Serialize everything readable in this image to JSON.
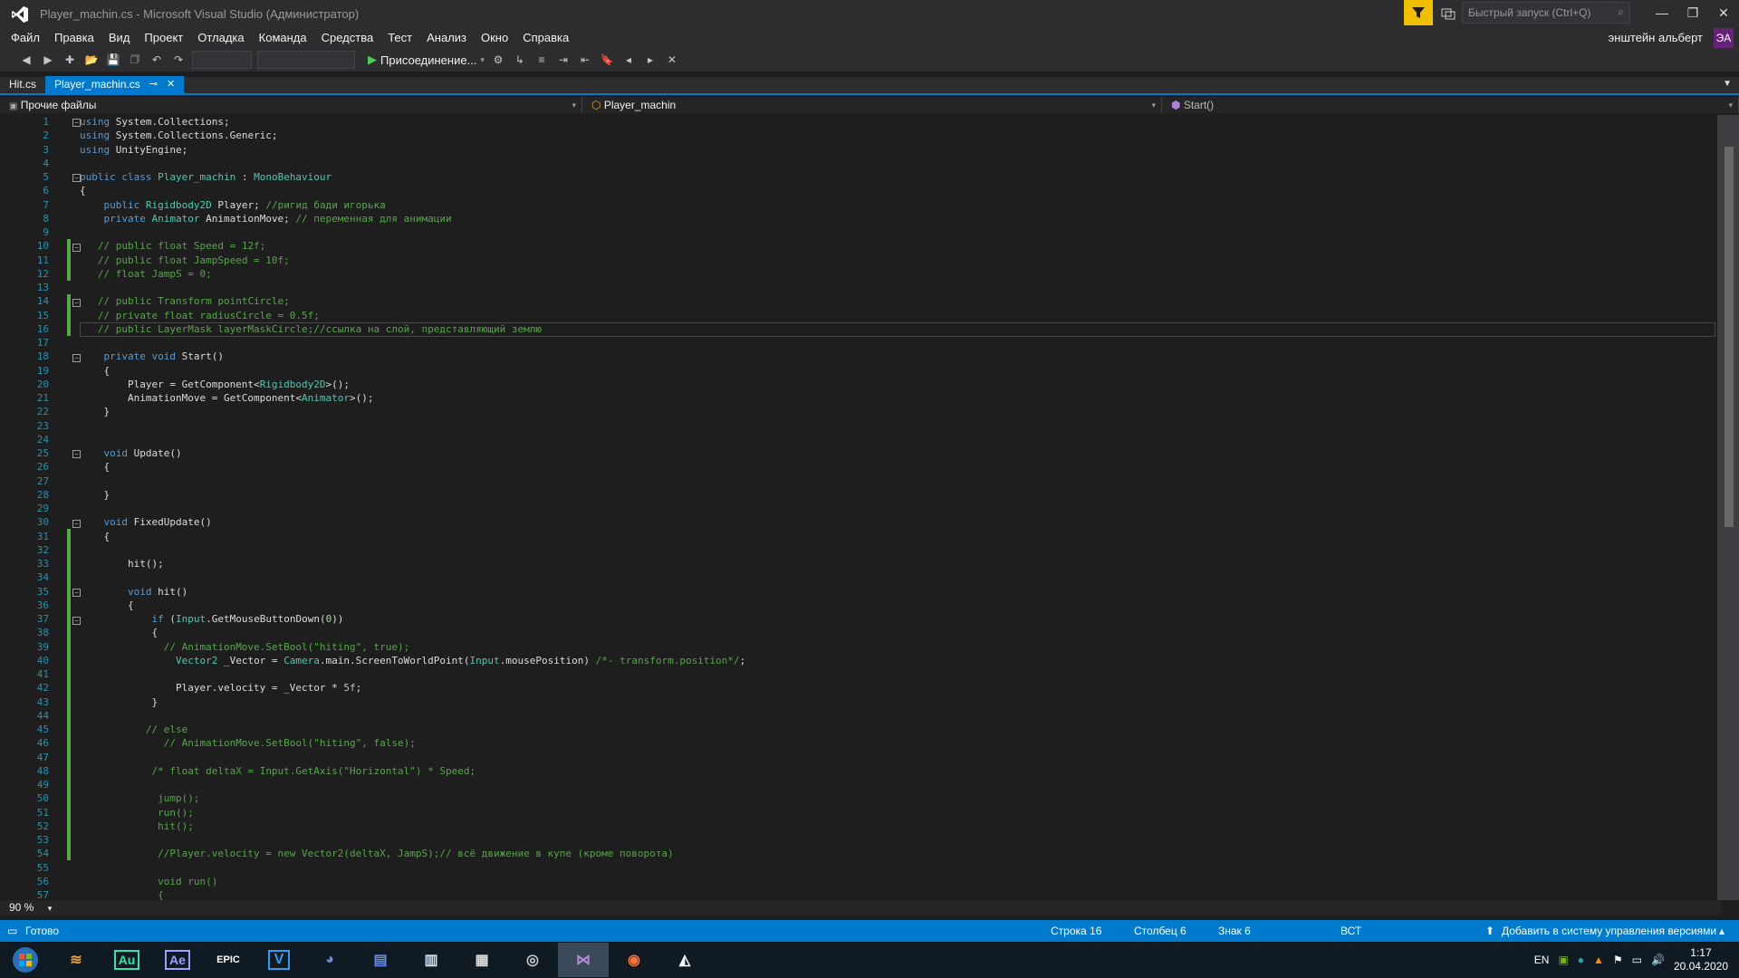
{
  "titlebar": {
    "title": "Player_machin.cs - Microsoft Visual Studio  (Администратор)",
    "quick_launch_placeholder": "Быстрый запуск (Ctrl+Q)",
    "user_name": "энштейн альберт",
    "avatar_initials": "ЭА"
  },
  "menu": [
    "Файл",
    "Правка",
    "Вид",
    "Проект",
    "Отладка",
    "Команда",
    "Средства",
    "Тест",
    "Анализ",
    "Окно",
    "Справка"
  ],
  "toolbar": {
    "attach_label": "Присоединение..."
  },
  "tabs": [
    {
      "label": "Hit.cs",
      "active": false
    },
    {
      "label": "Player_machin.cs",
      "active": true
    }
  ],
  "navbar": {
    "project": "Прочие файлы",
    "class": "Player_machin",
    "member": "Start()"
  },
  "code": {
    "current_line": 16,
    "lines": [
      {
        "n": 1,
        "html": "<span class='kw'>using</span> System.Collections;"
      },
      {
        "n": 2,
        "html": "<span class='kw'>using</span> System.Collections.Generic;"
      },
      {
        "n": 3,
        "html": "<span class='kw'>using</span> UnityEngine;"
      },
      {
        "n": 4,
        "html": ""
      },
      {
        "n": 5,
        "html": "<span class='kw'>public class</span> <span class='ty'>Player_machin</span> : <span class='ty'>MonoBehaviour</span>"
      },
      {
        "n": 6,
        "html": "{"
      },
      {
        "n": 7,
        "html": "    <span class='kw'>public</span> <span class='ty'>Rigidbody2D</span> Player; <span class='cm'>//ригид бади игорька</span>"
      },
      {
        "n": 8,
        "html": "    <span class='kw'>private</span> <span class='ty'>Animator</span> AnimationMove; <span class='cm'>// переменная для анимации</span>"
      },
      {
        "n": 9,
        "html": ""
      },
      {
        "n": 10,
        "html": "   <span class='cm'>// public float Speed = 12f;</span>"
      },
      {
        "n": 11,
        "html": "   <span class='cm'>// public float JampSpeed = 10f;</span>"
      },
      {
        "n": 12,
        "html": "   <span class='cm'>// float JampS = 0;</span>"
      },
      {
        "n": 13,
        "html": ""
      },
      {
        "n": 14,
        "html": "   <span class='cm'>// public Transform pointCircle;</span>"
      },
      {
        "n": 15,
        "html": "   <span class='cm'>// private float radiusCircle = 0.5f;</span>"
      },
      {
        "n": 16,
        "html": "   <span class='cm'>// public LayerMask layerMaskCircle;//ссылка на слой, представляющий землю</span>"
      },
      {
        "n": 17,
        "html": ""
      },
      {
        "n": 18,
        "html": "    <span class='kw'>private void</span> Start()"
      },
      {
        "n": 19,
        "html": "    {"
      },
      {
        "n": 20,
        "html": "        Player = GetComponent&lt;<span class='ty'>Rigidbody2D</span>&gt;();"
      },
      {
        "n": 21,
        "html": "        AnimationMove = GetComponent&lt;<span class='ty'>Animator</span>&gt;();"
      },
      {
        "n": 22,
        "html": "    }"
      },
      {
        "n": 23,
        "html": ""
      },
      {
        "n": 24,
        "html": ""
      },
      {
        "n": 25,
        "html": "    <span class='kw'>void</span> Update()"
      },
      {
        "n": 26,
        "html": "    {"
      },
      {
        "n": 27,
        "html": ""
      },
      {
        "n": 28,
        "html": "    }"
      },
      {
        "n": 29,
        "html": ""
      },
      {
        "n": 30,
        "html": "    <span class='kw'>void</span> FixedUpdate()"
      },
      {
        "n": 31,
        "html": "    {"
      },
      {
        "n": 32,
        "html": ""
      },
      {
        "n": 33,
        "html": "        hit();"
      },
      {
        "n": 34,
        "html": ""
      },
      {
        "n": 35,
        "html": "        <span class='kw'>void</span> hit()"
      },
      {
        "n": 36,
        "html": "        {"
      },
      {
        "n": 37,
        "html": "            <span class='kw'>if</span> (<span class='ty'>Input</span>.GetMouseButtonDown(<span class='nm'>0</span>))"
      },
      {
        "n": 38,
        "html": "            {"
      },
      {
        "n": 39,
        "html": "              <span class='cm'>// AnimationMove.SetBool(\"hiting\", true);</span>"
      },
      {
        "n": 40,
        "html": "                <span class='ty'>Vector2</span> _Vector = <span class='ty'>Camera</span>.main.ScreenToWorldPoint(<span class='ty'>Input</span>.mousePosition) <span class='cm'>/*- transform.position*/</span>;"
      },
      {
        "n": 41,
        "html": ""
      },
      {
        "n": 42,
        "html": "                Player.velocity = _Vector * <span class='nm'>5f</span>;"
      },
      {
        "n": 43,
        "html": "            }"
      },
      {
        "n": 44,
        "html": ""
      },
      {
        "n": 45,
        "html": "           <span class='cm'>// else</span>"
      },
      {
        "n": 46,
        "html": "              <span class='cm'>// AnimationMove.SetBool(\"hiting\", false);</span>"
      },
      {
        "n": 47,
        "html": ""
      },
      {
        "n": 48,
        "html": "            <span class='cm'>/* float deltaX = Input.GetAxis(\"Horizontal\") * Speed;</span>"
      },
      {
        "n": 49,
        "html": ""
      },
      {
        "n": 50,
        "html": "             <span class='cm'>jump();</span>"
      },
      {
        "n": 51,
        "html": "             <span class='cm'>run();</span>"
      },
      {
        "n": 52,
        "html": "             <span class='cm'>hit();</span>"
      },
      {
        "n": 53,
        "html": ""
      },
      {
        "n": 54,
        "html": "             <span class='cm'>//Player.velocity = new Vector2(deltaX, JampS);// всё движение в купе (кроме поворота)</span>"
      },
      {
        "n": 55,
        "html": ""
      },
      {
        "n": 56,
        "html": "             <span class='cm'>void run()</span>"
      },
      {
        "n": 57,
        "html": "             <span class='cm'>{</span>"
      }
    ]
  },
  "zoom": "90 %",
  "status": {
    "ready": "Готово",
    "row": "Строка 16",
    "col": "Столбец 6",
    "char": "Знак 6",
    "mode": "ВСТ",
    "vcs": "Добавить в систему управления версиями"
  },
  "taskbar": {
    "apps": [
      "start",
      "files",
      "Au",
      "Ae",
      "EPIC",
      "V",
      "discord",
      "save",
      "notepad",
      "doc",
      "steam",
      "vs",
      "firefox",
      "unity"
    ],
    "lang": "EN",
    "time": "1:17",
    "date": "20.04.2020"
  },
  "colors": {
    "accent": "#007acc",
    "keyword": "#569cd6",
    "type": "#4ec9b0",
    "comment": "#57a64a",
    "line_number": "#2b91af"
  }
}
